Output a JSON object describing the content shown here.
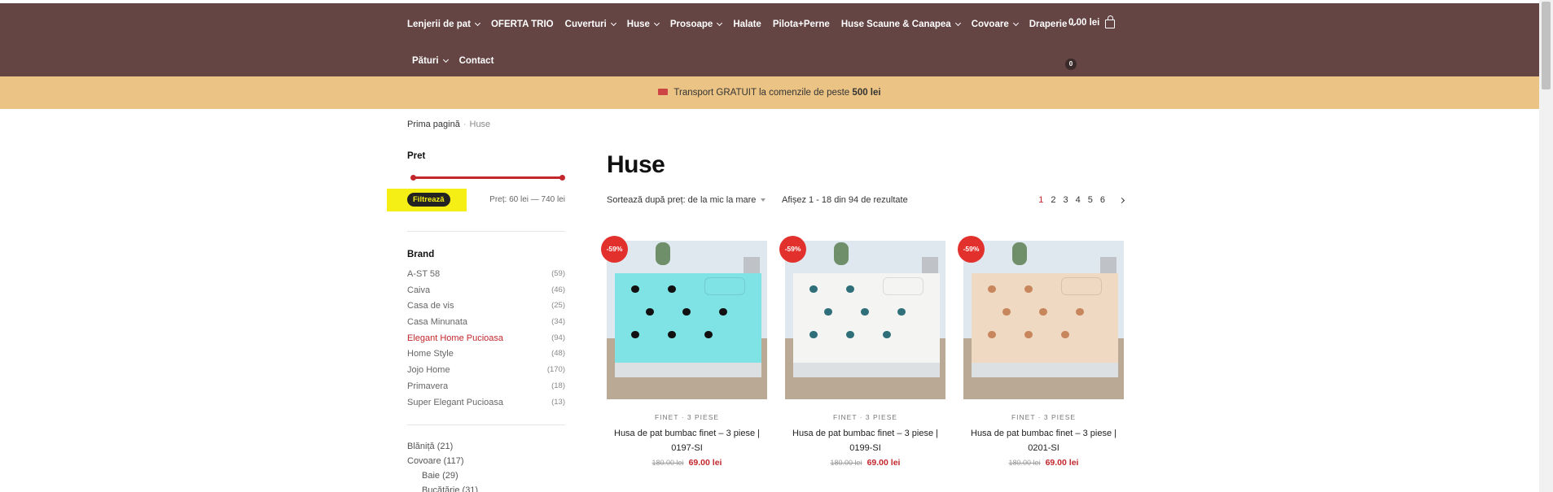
{
  "colors": {
    "header_bg": "#654444",
    "promo_bg": "#ebc384",
    "accent": "#c2272d",
    "badge": "#e2302d",
    "filter_highlight": "#f5ef16"
  },
  "nav": {
    "row1": [
      {
        "label": "Lenjerii de pat",
        "dropdown": true
      },
      {
        "label": "OFERTA TRIO",
        "dropdown": false
      },
      {
        "label": "Cuverturi",
        "dropdown": true
      },
      {
        "label": "Huse",
        "dropdown": true
      },
      {
        "label": "Prosoape",
        "dropdown": true
      },
      {
        "label": "Halate",
        "dropdown": false
      },
      {
        "label": "Pilota+Perne",
        "dropdown": false
      },
      {
        "label": "Huse Scaune & Canapea",
        "dropdown": true
      },
      {
        "label": "Covoare",
        "dropdown": true
      },
      {
        "label": "Draperie",
        "dropdown": true
      }
    ],
    "row2": [
      {
        "label": "Pături",
        "dropdown": true
      },
      {
        "label": "Contact",
        "dropdown": false
      }
    ],
    "cart_total": "0.00 lei",
    "cart_count": "0"
  },
  "promo": {
    "text": "Transport GRATUIT la comenzile de peste",
    "bold": "500 lei"
  },
  "breadcrumb": {
    "home": "Prima pagină",
    "current": "Huse"
  },
  "sidebar": {
    "price_title": "Pret",
    "filter_button": "Filtrează",
    "price_range": "Preț: 60 lei — 740 lei",
    "brand_title": "Brand",
    "brands": [
      {
        "name": "A-ST 58",
        "count": "(59)"
      },
      {
        "name": "Caiva",
        "count": "(46)"
      },
      {
        "name": "Casa de vis",
        "count": "(25)"
      },
      {
        "name": "Casa Minunata",
        "count": "(34)"
      },
      {
        "name": "Elegant Home Pucioasa",
        "count": "(94)",
        "active": true
      },
      {
        "name": "Home Style",
        "count": "(48)"
      },
      {
        "name": "Jojo Home",
        "count": "(170)"
      },
      {
        "name": "Primavera",
        "count": "(18)"
      },
      {
        "name": "Super Elegant Pucioasa",
        "count": "(13)"
      }
    ],
    "categories": [
      {
        "label": "Blăniță (21)",
        "sub": false
      },
      {
        "label": "Covoare (117)",
        "sub": false
      },
      {
        "label": "Baie (29)",
        "sub": true
      },
      {
        "label": "Bucătărie (31)",
        "sub": true
      }
    ]
  },
  "main": {
    "title": "Huse",
    "sort_label": "Sortează după preț: de la mic la mare",
    "results": "Afișez 1 - 18 din 94 de rezultate",
    "pages": [
      "1",
      "2",
      "3",
      "4",
      "5",
      "6"
    ]
  },
  "products": [
    {
      "badge": "-59%",
      "category": "FINET · 3 PIESE",
      "name_line1": "Husa de pat bumbac finet – 3 piese |",
      "name_line2": "0197-SI",
      "old_price": "180.00 lei",
      "new_price": "69.00 lei",
      "image": "turquoise-hearts",
      "bed_color": "#7fe3e6",
      "pattern_color": "#111111"
    },
    {
      "badge": "-59%",
      "category": "FINET · 3 PIESE",
      "name_line1": "Husa de pat bumbac finet – 3 piese |",
      "name_line2": "0199-SI",
      "old_price": "180.00 lei",
      "new_price": "69.00 lei",
      "image": "white-butterflies",
      "bed_color": "#f4f4f2",
      "pattern_color": "#2f6f7a"
    },
    {
      "badge": "-59%",
      "category": "FINET · 3 PIESE",
      "name_line1": "Husa de pat bumbac finet – 3 piese |",
      "name_line2": "0201-SI",
      "old_price": "180.00 lei",
      "new_price": "69.00 lei",
      "image": "beige-flowers",
      "bed_color": "#efd9c2",
      "pattern_color": "#c8865c"
    }
  ]
}
